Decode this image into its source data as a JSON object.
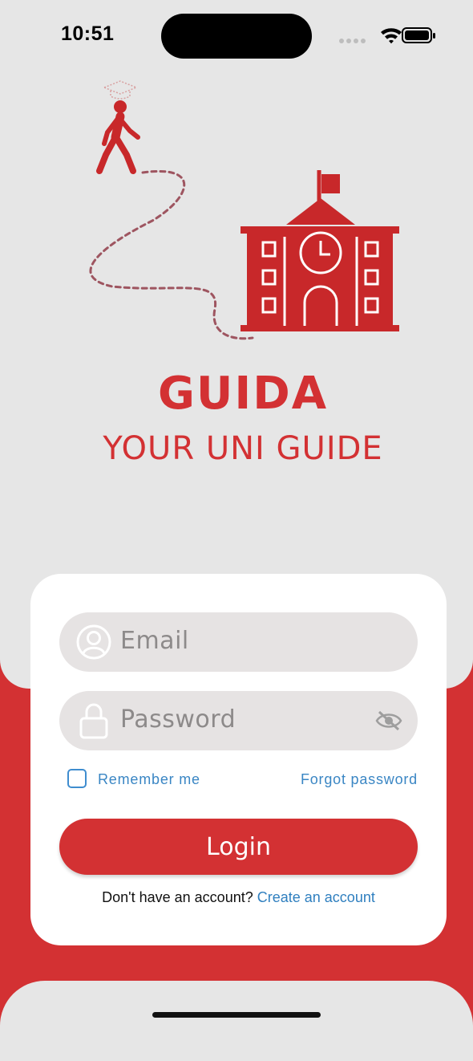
{
  "status_bar": {
    "time": "10:51"
  },
  "brand": {
    "title": "GUIDA",
    "subtitle": "YOUR UNI GUIDE"
  },
  "login_form": {
    "email_placeholder": "Email",
    "password_placeholder": "Password",
    "remember_label": "Remember me",
    "forgot_label": "Forgot password",
    "login_label": "Login",
    "signup_prompt": "Don't have an account?",
    "signup_link": "Create an account"
  },
  "colors": {
    "accent": "#d33133",
    "background": "#e6e6e6",
    "field_background": "#e6e3e3",
    "link": "#3a86c4"
  },
  "icons": [
    "signal-icon",
    "wifi-icon",
    "battery-icon",
    "student-walking-icon",
    "dotted-path",
    "university-building-icon",
    "user-icon",
    "lock-icon",
    "eye-off-icon"
  ]
}
